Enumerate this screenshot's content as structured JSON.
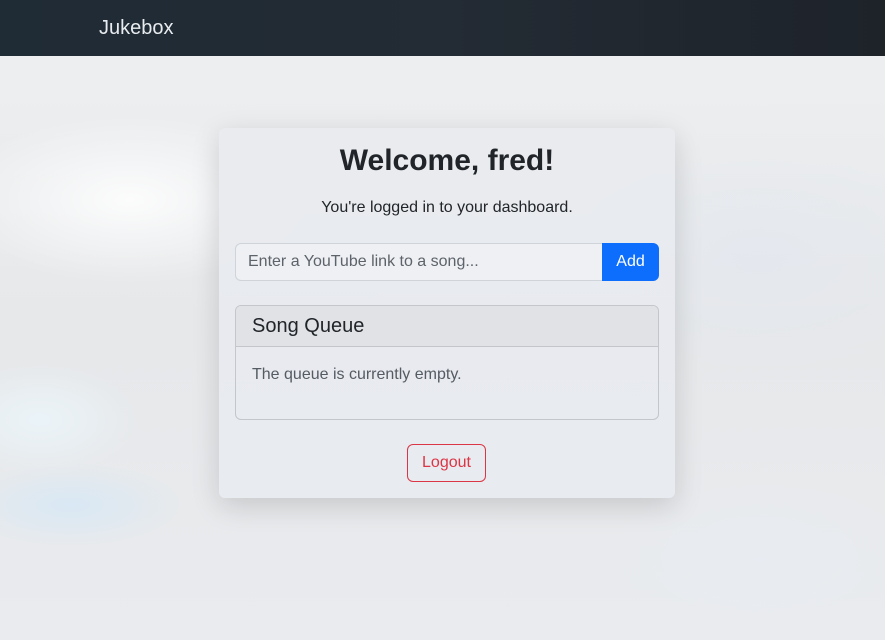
{
  "navbar": {
    "brand": "Jukebox"
  },
  "dashboard": {
    "title": "Welcome, fred!",
    "subtitle": "You're logged in to your dashboard.",
    "song_input": {
      "value": "",
      "placeholder": "Enter a YouTube link to a song..."
    },
    "add_label": "Add",
    "logout_label": "Logout"
  },
  "queue": {
    "title": "Song Queue",
    "empty_message": "The queue is currently empty."
  },
  "colors": {
    "primary": "#0d6efd",
    "danger": "#dc3545",
    "navbar": "#212a33"
  }
}
